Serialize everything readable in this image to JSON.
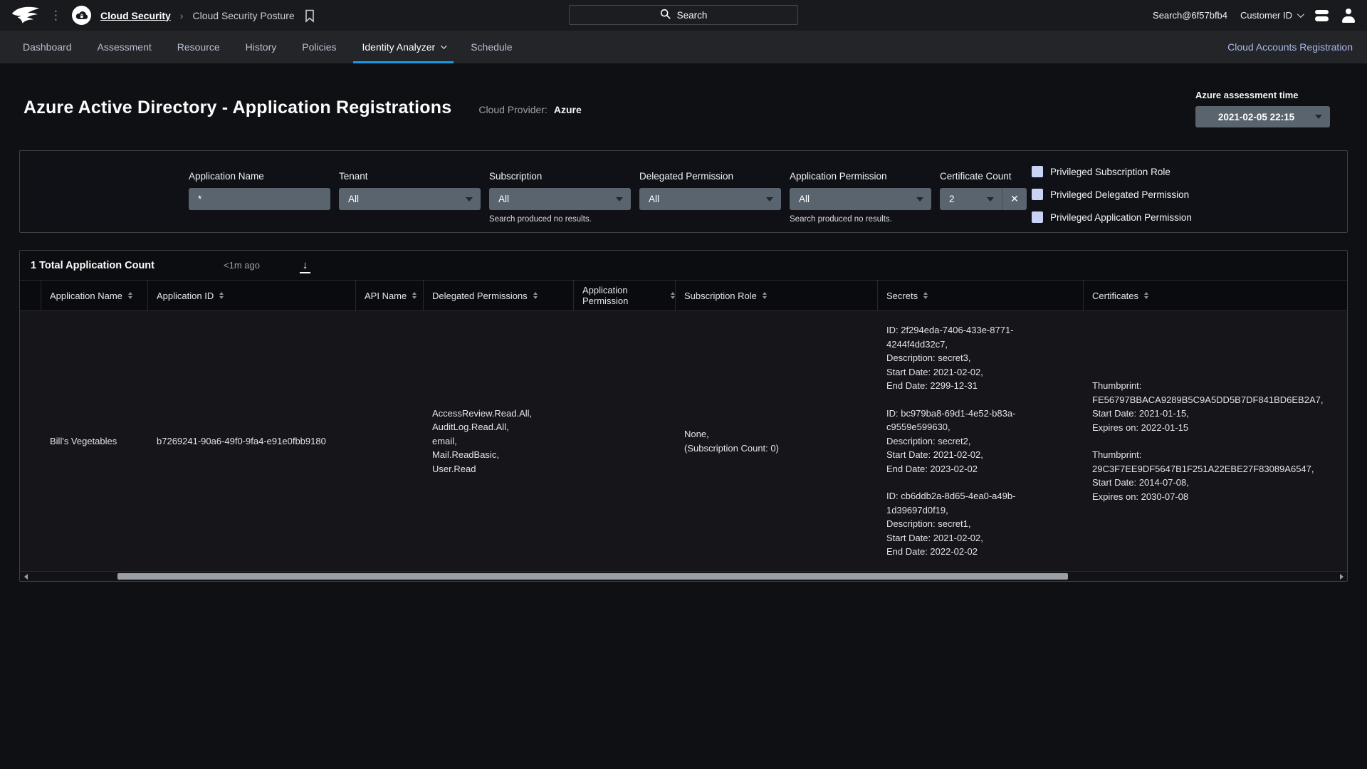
{
  "icons": {
    "ellipsis": "⋮",
    "breadcrumb_separator": "›",
    "download_arrow": "↓",
    "clear": "✕"
  },
  "topbar": {
    "breadcrumb": {
      "root": "Cloud Security",
      "current": "Cloud Security Posture"
    },
    "search_placeholder": "Search",
    "user": "Search@6f57bfb4",
    "customer_label": "Customer ID"
  },
  "nav": {
    "tabs": [
      {
        "label": "Dashboard"
      },
      {
        "label": "Assessment"
      },
      {
        "label": "Resource"
      },
      {
        "label": "History"
      },
      {
        "label": "Policies"
      },
      {
        "label": "Identity Analyzer"
      },
      {
        "label": "Schedule"
      }
    ],
    "right_link": "Cloud Accounts Registration"
  },
  "page": {
    "title": "Azure Active Directory - Application Registrations",
    "cloud_provider_label": "Cloud Provider:",
    "cloud_provider_value": "Azure",
    "assessment_time_label": "Azure assessment time",
    "assessment_time_value": "2021-02-05 22:15"
  },
  "filters": {
    "application_name": {
      "label": "Application Name",
      "value": "*"
    },
    "tenant": {
      "label": "Tenant",
      "value": "All"
    },
    "subscription": {
      "label": "Subscription",
      "value": "All",
      "hint": "Search produced no results."
    },
    "delegated_permission": {
      "label": "Delegated Permission",
      "value": "All"
    },
    "application_permission": {
      "label": "Application Permission",
      "value": "All",
      "hint": "Search produced no results."
    },
    "certificate_count": {
      "label": "Certificate Count",
      "value": "2"
    },
    "checkboxes": [
      {
        "label": "Privileged Subscription Role",
        "checked": false
      },
      {
        "label": "Privileged Delegated Permission",
        "checked": false
      },
      {
        "label": "Privileged Application Permission",
        "checked": false
      }
    ]
  },
  "table": {
    "summary": "1 Total Application Count",
    "updated": "<1m ago",
    "columns": [
      "Application Name",
      "Application ID",
      "API Name",
      "Delegated Permissions",
      "Application Permission",
      "Subscription Role",
      "Secrets",
      "Certificates"
    ],
    "row": {
      "application_name": "Bill's Vegetables",
      "application_id": "b7269241-90a6-49f0-9fa4-e91e0fbb9180",
      "api_name": "",
      "delegated_permissions": "AccessReview.Read.All,\nAuditLog.Read.All,\nemail,\nMail.ReadBasic,\nUser.Read",
      "application_permission": "",
      "subscription_role": "None,\n(Subscription Count: 0)",
      "secrets": [
        "ID: 2f294eda-7406-433e-8771-\n4244f4dd32c7,\nDescription: secret3,\nStart Date: 2021-02-02,\nEnd Date: 2299-12-31",
        "ID: bc979ba8-69d1-4e52-b83a-\nc9559e599630,\nDescription: secret2,\nStart Date: 2021-02-02,\nEnd Date: 2023-02-02",
        "ID: cb6ddb2a-8d65-4ea0-a49b-\n1d39697d0f19,\nDescription: secret1,\nStart Date: 2021-02-02,\nEnd Date: 2022-02-02"
      ],
      "certificates": [
        "Thumbprint:\nFE56797BBACA9289B5C9A5DD5B7DF841BD6EB2A7,\nStart Date: 2021-01-15,\nExpires on: 2022-01-15",
        "Thumbprint:\n29C3F7EE9DF5647B1F251A22EBE27F83089A6547,\nStart Date: 2014-07-08,\nExpires on: 2030-07-08"
      ]
    }
  },
  "colors": {
    "accent_blue": "#189ae8",
    "link": "#a9b9ea",
    "control_grey": "#5a646e",
    "checkbox_fill": "#c9d3f5"
  }
}
